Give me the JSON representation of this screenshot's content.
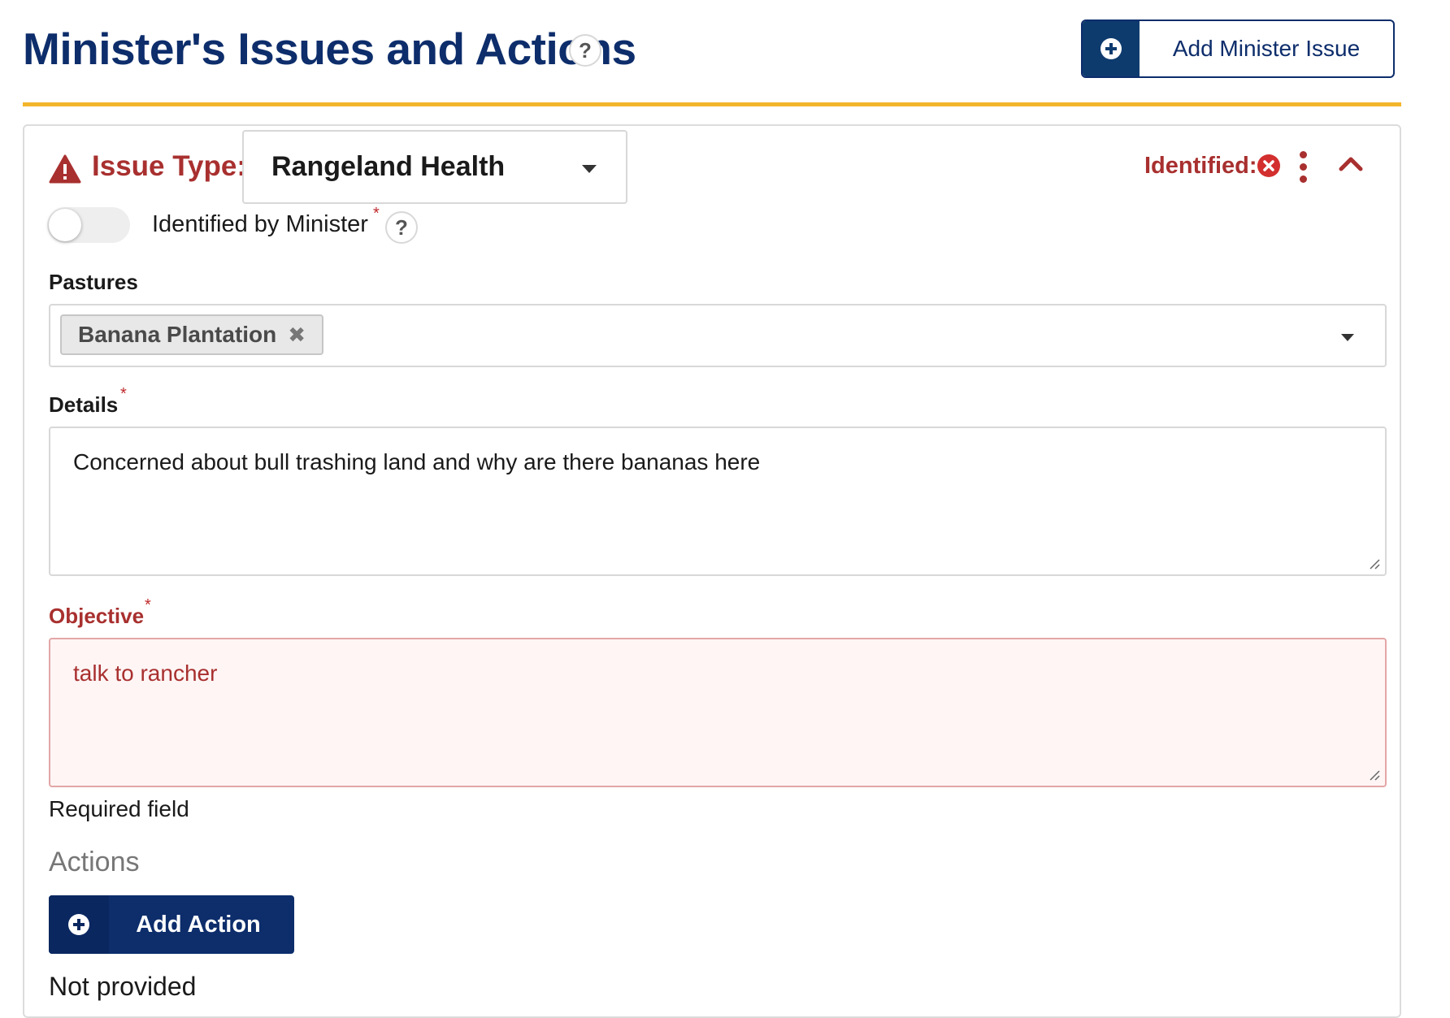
{
  "header": {
    "title": "Minister's Issues and Actions",
    "help_glyph": "?",
    "add_issue_label": "Add Minister Issue"
  },
  "colors": {
    "primary": "#0d2d6b",
    "accent_rule": "#f3b52b",
    "error": "#a8302f"
  },
  "issue": {
    "type_label": "Issue Type:",
    "type_value": "Rangeland Health",
    "status_label": "Identified:",
    "status_icon": "x-circle-icon",
    "identified_by_minister": {
      "label": "Identified by Minister",
      "required_mark": "*",
      "checked": false
    },
    "pastures": {
      "label": "Pastures",
      "selected": [
        {
          "label": "Banana Plantation",
          "remove_glyph": "✖"
        }
      ]
    },
    "details": {
      "label": "Details",
      "required_mark": "*",
      "value": "Concerned about bull trashing land and why are there bananas here"
    },
    "objective": {
      "label": "Objective",
      "required_mark": "*",
      "value": "talk to rancher",
      "error_text": "Required field"
    },
    "actions": {
      "heading": "Actions",
      "add_label": "Add Action",
      "empty_text": "Not provided"
    }
  }
}
